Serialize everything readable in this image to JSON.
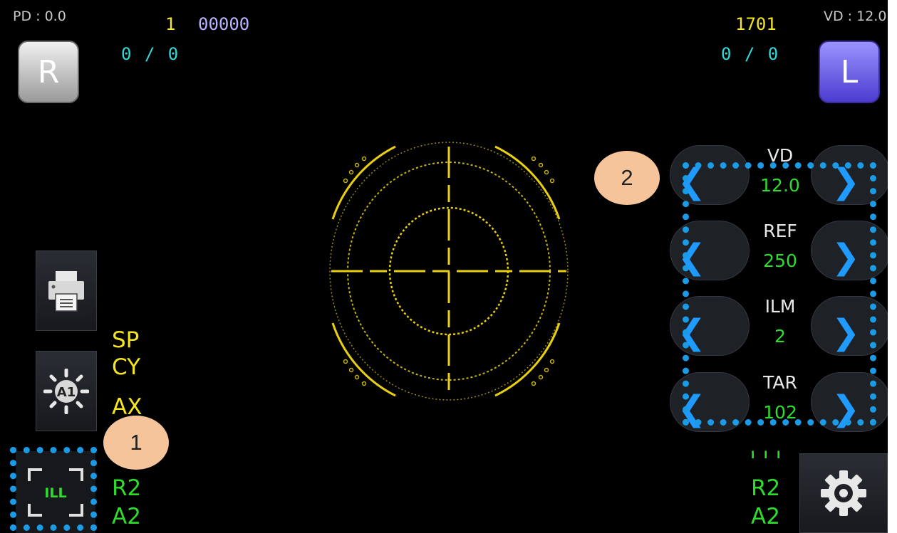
{
  "header": {
    "pd": "PD : 0.0",
    "vd": "VD : 12.0",
    "right_number": "1",
    "right_code": "00000",
    "left_number": "1701",
    "right_ratio": "0 / 0",
    "left_ratio": "0 / 0"
  },
  "eye_buttons": {
    "right": "R",
    "left": "L"
  },
  "left_labels": {
    "sp": "SP",
    "cy": "CY",
    "ax": "AX",
    "r2": "R2",
    "a2": "A2"
  },
  "right_labels": {
    "r2": "R2",
    "a2": "A2",
    "partial": "I I I"
  },
  "ill_button": {
    "label": "ILL"
  },
  "brightness_button": {
    "label": "A1"
  },
  "controls": [
    {
      "title": "VD",
      "value": "12.0"
    },
    {
      "title": "REF",
      "value": "250"
    },
    {
      "title": "ILM",
      "value": "2"
    },
    {
      "title": "TAR",
      "value": "102"
    }
  ],
  "arrows": {
    "left": "❮",
    "right": "❯"
  },
  "callouts": {
    "one": "1",
    "two": "2"
  },
  "colors": {
    "accent_yellow": "#f4e51e",
    "value_green": "#2ddc2d",
    "callout_blue": "#1a9be6",
    "callout_badge": "#f6c49a"
  },
  "icons": [
    "printer-icon",
    "brightness-a1-icon",
    "ill-frame-icon",
    "gear-icon",
    "chevron-left-icon",
    "chevron-right-icon",
    "reticle-target"
  ]
}
